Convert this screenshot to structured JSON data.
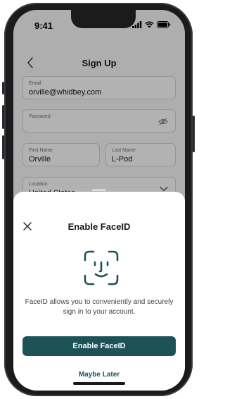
{
  "status": {
    "time": "9:41",
    "icons": [
      "signal-icon",
      "wifi-icon",
      "battery-icon"
    ]
  },
  "header": {
    "title": "Sign Up",
    "back_icon": "chevron-left-icon"
  },
  "form": {
    "email_label": "Email",
    "email_value": "orville@whidbey.com",
    "password_label": "Password",
    "password_value": "",
    "password_icon": "eye-off-icon",
    "first_name_label": "First Name",
    "first_name_value": "Orville",
    "last_name_label": "Last Name",
    "last_name_value": "L-Pod",
    "location_label": "Location",
    "location_value": "United States",
    "location_icon": "chevron-down-icon"
  },
  "sheet": {
    "title": "Enable FaceID",
    "close_icon": "close-icon",
    "face_icon": "faceid-icon",
    "description": "FaceID allows you to conveniently and securely sign in to your account.",
    "primary_label": "Enable FaceID",
    "secondary_label": "Maybe Later"
  },
  "colors": {
    "accent": "#1d5256",
    "overlay": "rgba(0,0,0,0.28)"
  }
}
